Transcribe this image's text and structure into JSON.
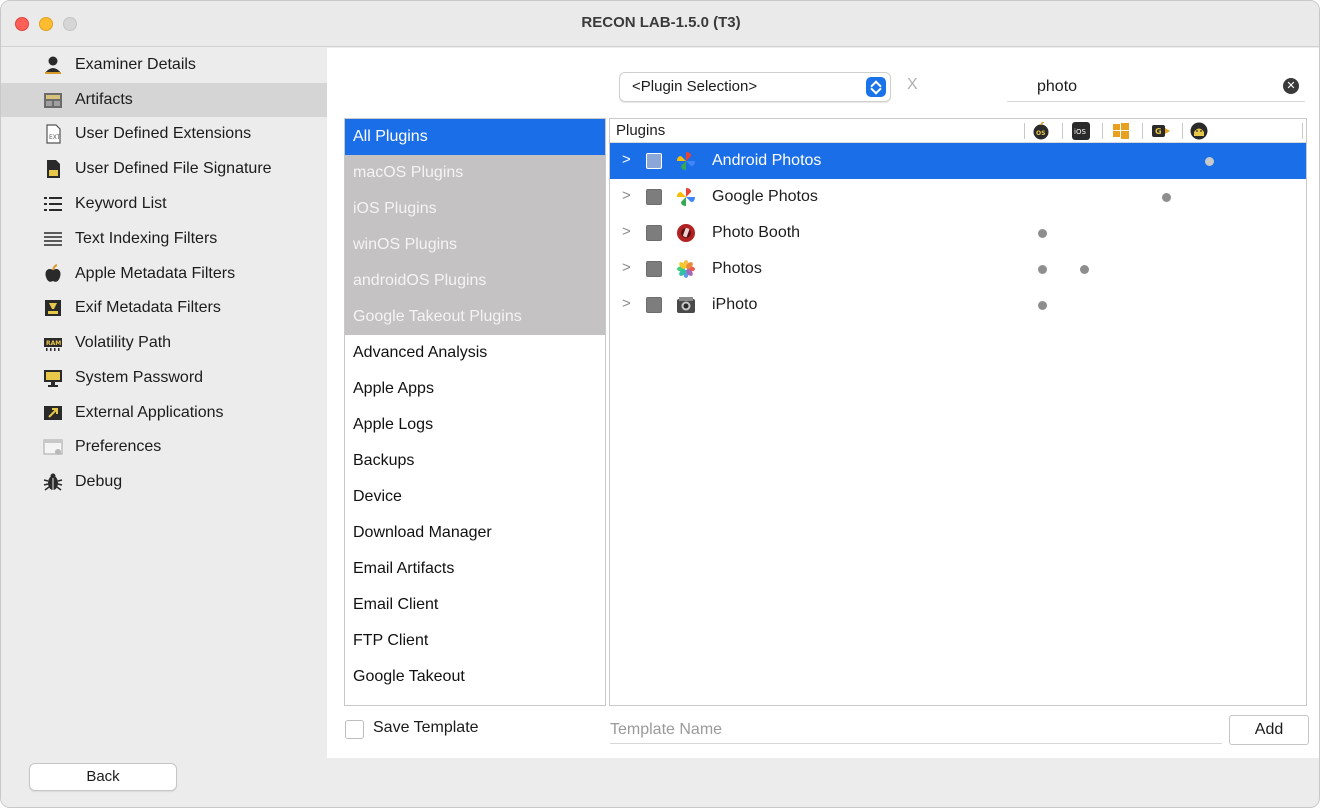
{
  "window": {
    "title": "RECON LAB-1.5.0 (T3)"
  },
  "sidebar": {
    "items": [
      {
        "label": "Examiner Details",
        "icon": "person-icon"
      },
      {
        "label": "Artifacts",
        "icon": "artifacts-icon",
        "selected": true
      },
      {
        "label": "User Defined Extensions",
        "icon": "ext-file-icon"
      },
      {
        "label": "User Defined File Signature",
        "icon": "signature-file-icon"
      },
      {
        "label": "Keyword List",
        "icon": "list-icon"
      },
      {
        "label": "Text Indexing Filters",
        "icon": "text-list-icon"
      },
      {
        "label": "Apple Metadata Filters",
        "icon": "apple-icon"
      },
      {
        "label": "Exif Metadata Filters",
        "icon": "exif-icon"
      },
      {
        "label": "Volatility Path",
        "icon": "ram-icon"
      },
      {
        "label": "System Password",
        "icon": "monitor-icon"
      },
      {
        "label": "External Applications",
        "icon": "external-app-icon"
      },
      {
        "label": "Preferences",
        "icon": "preferences-icon"
      },
      {
        "label": "Debug",
        "icon": "bug-icon"
      }
    ],
    "back_label": "Back"
  },
  "toolbar": {
    "plugin_selection": "<Plugin Selection>",
    "clear_label": "X",
    "search_value": "photo"
  },
  "categories": [
    {
      "label": "All Plugins",
      "state": "active"
    },
    {
      "label": "macOS Plugins",
      "state": "grey"
    },
    {
      "label": "iOS Plugins",
      "state": "grey"
    },
    {
      "label": "winOS Plugins",
      "state": "grey"
    },
    {
      "label": "androidOS Plugins",
      "state": "grey"
    },
    {
      "label": "Google Takeout Plugins",
      "state": "grey"
    },
    {
      "label": "Advanced Analysis",
      "state": "normal"
    },
    {
      "label": "Apple Apps",
      "state": "normal"
    },
    {
      "label": "Apple Logs",
      "state": "normal"
    },
    {
      "label": "Backups",
      "state": "normal"
    },
    {
      "label": "Device",
      "state": "normal"
    },
    {
      "label": "Download Manager",
      "state": "normal"
    },
    {
      "label": "Email Artifacts",
      "state": "normal"
    },
    {
      "label": "Email Client",
      "state": "normal"
    },
    {
      "label": "FTP Client",
      "state": "normal"
    },
    {
      "label": "Google Takeout",
      "state": "normal"
    }
  ],
  "plugins_table": {
    "header": "Plugins",
    "os_columns": [
      "macos-icon",
      "ios-icon",
      "windows-icon",
      "google-takeout-icon",
      "android-icon"
    ],
    "rows": [
      {
        "label": "Android Photos",
        "icon": "pinwheel-icon",
        "selected": true,
        "os": [
          "android"
        ]
      },
      {
        "label": "Google Photos",
        "icon": "pinwheel-icon",
        "selected": false,
        "os": [
          "google-takeout"
        ]
      },
      {
        "label": "Photo Booth",
        "icon": "photo-booth-icon",
        "selected": false,
        "os": [
          "macos"
        ]
      },
      {
        "label": "Photos",
        "icon": "photos-flower-icon",
        "selected": false,
        "os": [
          "macos",
          "ios"
        ]
      },
      {
        "label": "iPhoto",
        "icon": "iphoto-icon",
        "selected": false,
        "os": [
          "macos"
        ]
      }
    ]
  },
  "footer": {
    "save_template_label": "Save Template",
    "template_placeholder": "Template Name",
    "add_label": "Add"
  }
}
